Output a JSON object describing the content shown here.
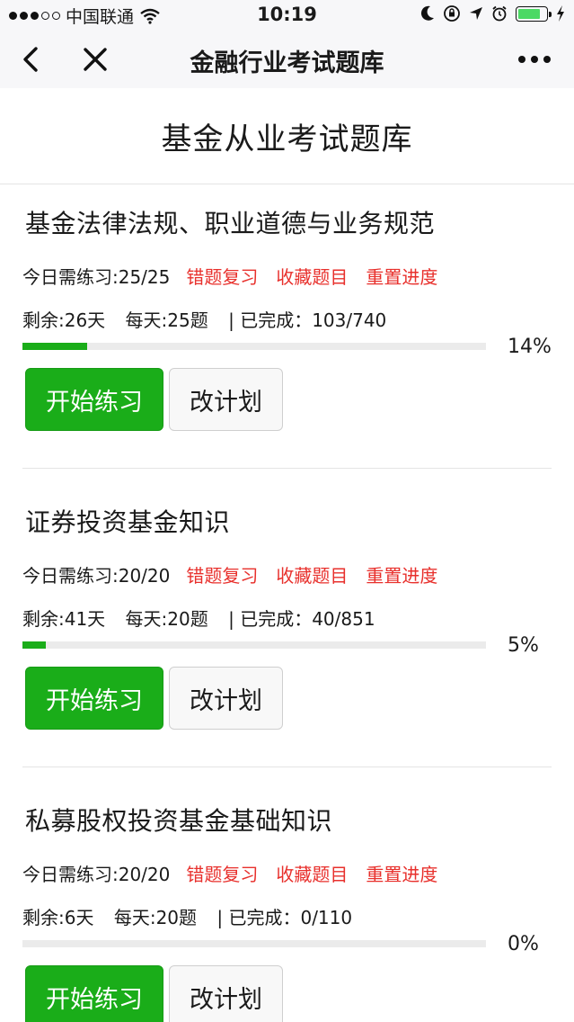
{
  "status_bar": {
    "carrier": "中国联通",
    "time": "10:19",
    "battery_level": 0.8,
    "icons": [
      "wifi-icon",
      "moon-icon",
      "orientation-lock-icon",
      "location-arrow-icon",
      "alarm-icon",
      "battery-icon",
      "charging-icon"
    ],
    "battery_color": "#4cd964"
  },
  "nav": {
    "title": "金融行业考试题库",
    "icons": [
      "back-chevron-icon",
      "close-icon",
      "more-dots-icon"
    ]
  },
  "page": {
    "title": "基金从业考试题库"
  },
  "colors": {
    "accent_green": "#1aad19",
    "link_red": "#e8302c"
  },
  "sections": [
    {
      "title": "基金法律法规、职业道德与业务规范",
      "today": "今日需练习:25/25",
      "links": [
        "错题复习",
        "收藏题目",
        "重置进度"
      ],
      "remaining": "剩余:26天",
      "daily": "每天:25题",
      "completed": "| 已完成：103/740",
      "progress": 14,
      "percent_label": "14%",
      "start_label": "开始练习",
      "plan_label": "改计划"
    },
    {
      "title": "证券投资基金知识",
      "today": "今日需练习:20/20",
      "links": [
        "错题复习",
        "收藏题目",
        "重置进度"
      ],
      "remaining": "剩余:41天",
      "daily": "每天:20题",
      "completed": "| 已完成：40/851",
      "progress": 5,
      "percent_label": "5%",
      "start_label": "开始练习",
      "plan_label": "改计划"
    },
    {
      "title": "私募股权投资基金基础知识",
      "today": "今日需练习:20/20",
      "links": [
        "错题复习",
        "收藏题目",
        "重置进度"
      ],
      "remaining": "剩余:6天",
      "daily": "每天:20题",
      "completed": "| 已完成：0/110",
      "progress": 0,
      "percent_label": "0%",
      "start_label": "开始练习",
      "plan_label": "改计划"
    }
  ]
}
